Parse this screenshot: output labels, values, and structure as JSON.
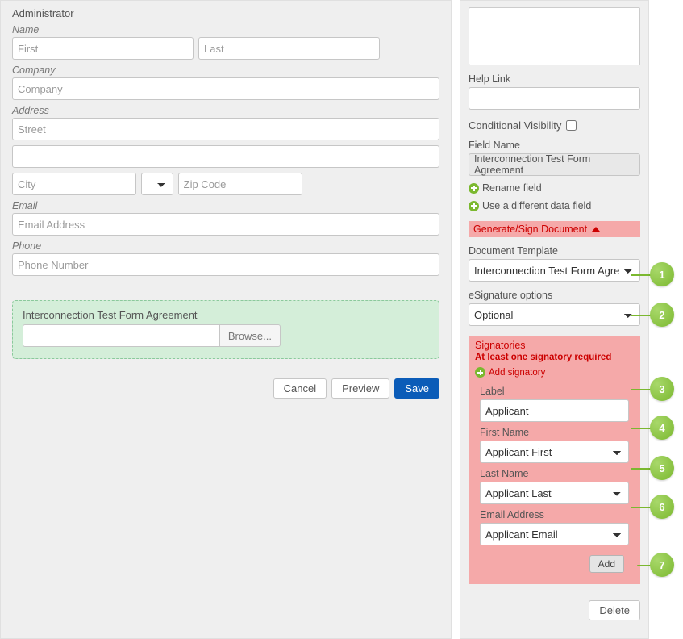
{
  "form": {
    "adminTitle": "Administrator",
    "nameLabel": "Name",
    "firstPlaceholder": "First",
    "lastPlaceholder": "Last",
    "companyLabel": "Company",
    "companyPlaceholder": "Company",
    "addressLabel": "Address",
    "streetPlaceholder": "Street",
    "cityPlaceholder": "City",
    "zipPlaceholder": "Zip Code",
    "emailLabel": "Email",
    "emailPlaceholder": "Email Address",
    "phoneLabel": "Phone",
    "phonePlaceholder": "Phone Number"
  },
  "agreement": {
    "title": "Interconnection Test Form Agreement",
    "browseLabel": "Browse..."
  },
  "buttons": {
    "cancel": "Cancel",
    "preview": "Preview",
    "save": "Save",
    "add": "Add",
    "delete": "Delete"
  },
  "right": {
    "helpLinkLabel": "Help Link",
    "conditionalVisibilityLabel": "Conditional Visibility",
    "fieldNameLabel": "Field Name",
    "fieldNameValue": "Interconnection Test Form Agreement",
    "renameField": "Rename field",
    "differentDataField": "Use a different data field",
    "generateSignHeader": "Generate/Sign Document",
    "documentTemplateLabel": "Document Template",
    "documentTemplateValue": "Interconnection Test Form Agre",
    "esigLabel": "eSignature options",
    "esigValue": "Optional",
    "signatoriesLabel": "Signatories",
    "signatoriesSub": "At least one signatory required",
    "addSignatory": "Add signatory",
    "sig": {
      "labelLabel": "Label",
      "labelValue": "Applicant",
      "firstNameLabel": "First Name",
      "firstNameValue": "Applicant First",
      "lastNameLabel": "Last Name",
      "lastNameValue": "Applicant Last",
      "emailLabel": "Email Address",
      "emailValue": "Applicant Email"
    }
  },
  "bubbles": [
    "1",
    "2",
    "3",
    "4",
    "5",
    "6",
    "7"
  ]
}
